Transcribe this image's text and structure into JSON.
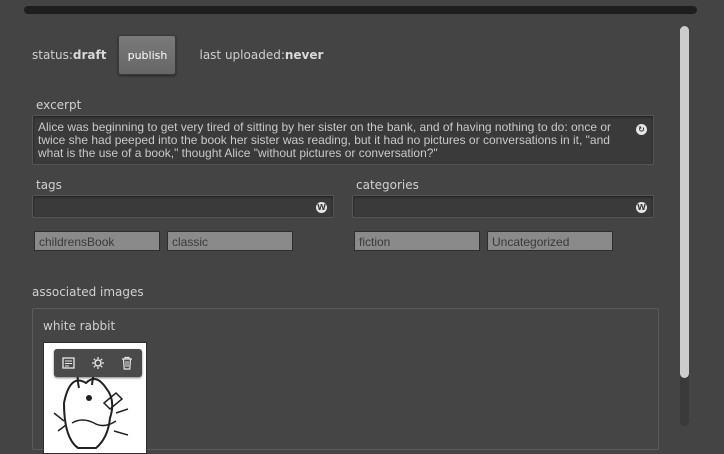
{
  "status": {
    "prefix": "status: ",
    "value": "draft"
  },
  "publish_label": "publish",
  "uploaded": {
    "prefix": "last uploaded: ",
    "value": "never"
  },
  "excerpt": {
    "label": "excerpt",
    "text": "Alice was beginning to get very tired of sitting by her sister on the bank, and of having nothing to do: once or twice she had peeped into the book her sister was reading, but it had no pictures or conversations in it, \"and what is the use of a book,\" thought Alice \"without pictures or conversation?\""
  },
  "tags": {
    "label": "tags",
    "items": [
      "childrensBook",
      "classic"
    ]
  },
  "categories": {
    "label": "categories",
    "items": [
      "fiction",
      "Uncategorized"
    ]
  },
  "associated_images": {
    "label": "associated images",
    "images": [
      {
        "title": "white rabbit"
      }
    ]
  },
  "icons": {
    "excerpt_action": "refresh-icon",
    "field_badge": "wordpress-icon",
    "image_tools": [
      "edit-icon",
      "settings-icon",
      "trash-icon"
    ]
  }
}
